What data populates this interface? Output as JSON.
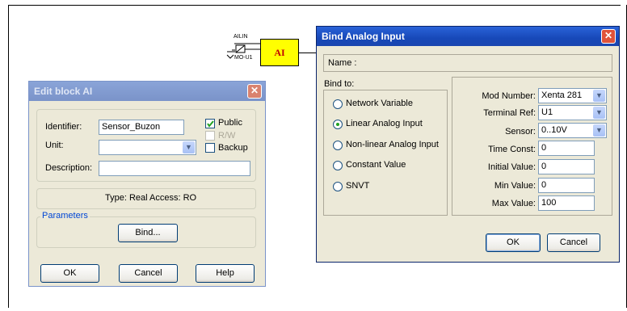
{
  "canvas": {
    "block": {
      "label": "AI",
      "input_label": "AILIN",
      "output_label": "MO-U1"
    }
  },
  "edit_block": {
    "title": "Edit block AI",
    "identifier_label": "Identifier:",
    "identifier_value": "Sensor_Buzon",
    "unit_label": "Unit:",
    "unit_value": "",
    "description_label": "Description:",
    "description_value": "",
    "public_label": "Public",
    "public_checked": true,
    "rw_label": "R/W",
    "backup_label": "Backup",
    "type_info": "Type: Real   Access: RO",
    "parameters_caption": "Parameters",
    "bind_button": "Bind...",
    "ok_button": "OK",
    "cancel_button": "Cancel",
    "help_button": "Help"
  },
  "bind_dialog": {
    "title": "Bind Analog Input",
    "name_label": "Name :",
    "bind_to_label": "Bind to:",
    "options": [
      "Network Variable",
      "Linear Analog Input",
      "Non-linear Analog Input",
      "Constant Value",
      "SNVT"
    ],
    "selected_option": "Linear Analog Input",
    "mod_number_label": "Mod Number:",
    "mod_number_value": "Xenta 281",
    "terminal_ref_label": "Terminal Ref:",
    "terminal_ref_value": "U1",
    "sensor_label": "Sensor:",
    "sensor_value": "0..10V",
    "time_const_label": "Time Const:",
    "time_const_value": "0",
    "initial_value_label": "Initial Value:",
    "initial_value_value": "0",
    "min_value_label": "Min Value:",
    "min_value_value": "0",
    "max_value_label": "Max Value:",
    "max_value_value": "100",
    "ok_button": "OK",
    "cancel_button": "Cancel"
  },
  "icons": {
    "close": "close-icon",
    "dropdown": "chevron-down-icon",
    "check": "check-icon"
  },
  "colors": {
    "title_active": "#1748b8",
    "title_inactive": "#7a93c9",
    "dialog_bg": "#ece9d8",
    "block_fill": "#ffff00",
    "block_text": "#c00000",
    "close_button": "#e0533a"
  }
}
